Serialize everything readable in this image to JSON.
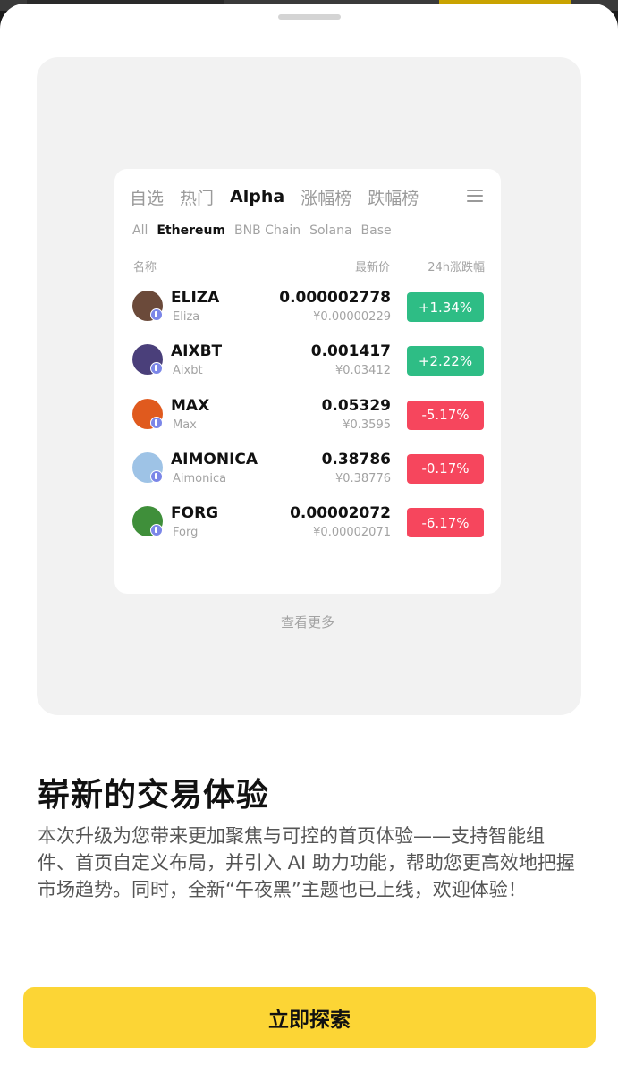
{
  "modal": {
    "title": "崭新的交易体验",
    "description": "本次升级为您带来更加聚焦与可控的首页体验——支持智能组件、首页自定义布局，并引入 AI 助力功能，帮助您更高效地把握市场趋势。同时，全新“午夜黑”主题也已上线，欢迎体验！",
    "cta_label": "立即探索"
  },
  "preview": {
    "tabs": [
      "自选",
      "热门",
      "Alpha",
      "涨幅榜",
      "跌幅榜"
    ],
    "active_tab": "Alpha",
    "chains": [
      "All",
      "Ethereum",
      "BNB Chain",
      "Solana",
      "Base"
    ],
    "active_chain": "Ethereum",
    "columns": {
      "name": "名称",
      "price": "最新价",
      "change": "24h涨跌幅"
    },
    "rows": [
      {
        "symbol": "ELIZA",
        "name": "Eliza",
        "price": "0.000002778",
        "cny": "¥0.00000229",
        "change": "+1.34%",
        "positive": true,
        "avatar_color": "#6b4a3a"
      },
      {
        "symbol": "AIXBT",
        "name": "Aixbt",
        "price": "0.001417",
        "cny": "¥0.03412",
        "change": "+2.22%",
        "positive": true,
        "avatar_color": "#4a3f7a"
      },
      {
        "symbol": "MAX",
        "name": "Max",
        "price": "0.05329",
        "cny": "¥0.3595",
        "change": "-5.17%",
        "positive": false,
        "avatar_color": "#e05a1e"
      },
      {
        "symbol": "AIMONICA",
        "name": "Aimonica",
        "price": "0.38786",
        "cny": "¥0.38776",
        "change": "-0.17%",
        "positive": false,
        "avatar_color": "#9ec3e6"
      },
      {
        "symbol": "FORG",
        "name": "Forg",
        "price": "0.00002072",
        "cny": "¥0.00002071",
        "change": "-6.17%",
        "positive": false,
        "avatar_color": "#3f8f3a"
      }
    ],
    "see_more": "查看更多"
  },
  "colors": {
    "accent": "#fcd535",
    "up": "#2ebd85",
    "down": "#f6465d"
  },
  "icons": {
    "menu": "hamburger-menu-icon",
    "chain_badge": "ethereum-icon"
  }
}
